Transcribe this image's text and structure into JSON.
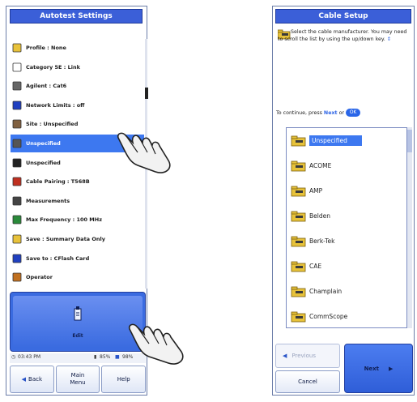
{
  "left_device": {
    "title": "Autotest Settings",
    "menu": [
      {
        "label": "Profile : None",
        "icon": "profile-icon",
        "selected": false
      },
      {
        "label": "Category 5E : Link",
        "icon": "document-icon",
        "selected": false
      },
      {
        "label": "Agilent : Cat6",
        "icon": "cable-icon",
        "selected": false
      },
      {
        "label": "Network Limits : off",
        "icon": "network-limits-icon",
        "selected": false
      },
      {
        "label": "Site : Unspecified",
        "icon": "site-icon",
        "selected": false
      },
      {
        "label": "Unspecified",
        "icon": "connector-icon",
        "selected": true
      },
      {
        "label": "Unspecified",
        "icon": "device-icon",
        "selected": false
      },
      {
        "label": "Cable Pairing : T568B",
        "icon": "cable-pairing-icon",
        "selected": false
      },
      {
        "label": "Measurements",
        "icon": "probe-icon",
        "selected": false
      },
      {
        "label": "Max Frequency : 100 MHz",
        "icon": "frequency-icon",
        "selected": false
      },
      {
        "label": "Save : Summary Data Only",
        "icon": "save-summary-icon",
        "selected": false
      },
      {
        "label": "Save to : CFlash Card",
        "icon": "floppy-icon",
        "selected": false
      },
      {
        "label": "Operator",
        "icon": "operator-icon",
        "selected": false
      }
    ],
    "big_button_label": "Edit",
    "status": {
      "time": "03:43 PM",
      "battery": "85%",
      "storage": "98%"
    },
    "buttons": {
      "back": "Back",
      "main_menu": "Main Menu",
      "help": "Help"
    }
  },
  "right_device": {
    "title": "Cable Setup",
    "instruction": "Select the cable manufacturer. You may need to scroll the list by using the up/down key.",
    "continue_text": "To continue, press",
    "continue_next": "Next",
    "continue_or": "or",
    "ok_label": "OK",
    "manufacturers": [
      "Unspecified",
      "ACOME",
      "AMP",
      "Belden",
      "Berk-Tek",
      "CAE",
      "Champlain",
      "CommScope"
    ],
    "selected_index": 0,
    "buttons": {
      "previous": "Previous",
      "cancel": "Cancel",
      "next": "Next"
    }
  },
  "colors": {
    "accent": "#3b5fd8",
    "selection": "#3d78f0"
  }
}
